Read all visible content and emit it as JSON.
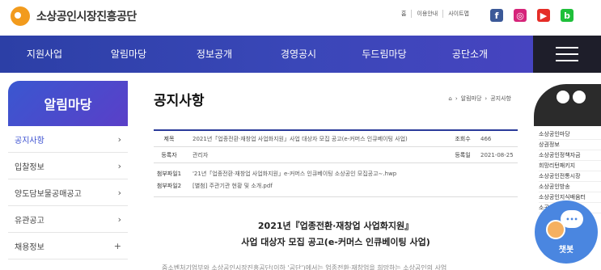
{
  "header": {
    "org_name": "소상공인시장진흥공단",
    "util_links": [
      "홈",
      "이용안내",
      "사이트맵"
    ],
    "sns": [
      {
        "name": "facebook-icon",
        "glyph": "f",
        "color": "#3b5998"
      },
      {
        "name": "instagram-icon",
        "glyph": "◎",
        "color": "#d6247a"
      },
      {
        "name": "youtube-icon",
        "glyph": "▶",
        "color": "#e52d27"
      },
      {
        "name": "blog-icon",
        "glyph": "b",
        "color": "#1fbf3a"
      }
    ]
  },
  "nav": {
    "items": [
      "지원사업",
      "알림마당",
      "정보공개",
      "경영공시",
      "두드림마당",
      "공단소개"
    ]
  },
  "sidebar": {
    "title": "알림마당",
    "items": [
      {
        "label": "공지사항",
        "arrow": "›"
      },
      {
        "label": "입찰정보",
        "arrow": "›"
      },
      {
        "label": "양도담보물공매공고",
        "arrow": "›"
      },
      {
        "label": "유관공고",
        "arrow": "›"
      },
      {
        "label": "채용정보",
        "arrow": "+"
      }
    ]
  },
  "main": {
    "title": "공지사항",
    "breadcrumb": [
      "알림마당",
      "공지사항"
    ],
    "info": {
      "subject_label": "제목",
      "subject": "2021년「업종전환·재창업 사업화지원」사업 대상자 모집 공고(e-커머스 인큐베이팅 사업)",
      "views_label": "조회수",
      "views": "466",
      "author_label": "등록자",
      "author": "관리자",
      "date_label": "등록일",
      "date": "2021-08-25",
      "files": [
        {
          "label": "첨부파일1",
          "name": "'21년「업종전환·재창업 사업화지원」e-커머스 인큐베이팅 소상공인 모집공고∼.hwp"
        },
        {
          "label": "첨부파일2",
          "name": "[별첨] 주관기관 현황 및 소개.pdf"
        }
      ]
    },
    "post_title_line1": "2021년『업종전환·재창업 사업화지원』",
    "post_title_line2": "사업 대상자 모집 공고(e-커머스 인큐베이팅 사업)",
    "body_fragment": "중소벤처기업부와 소상공인시장진흥공단(이하 '공단')에서는 업종전환·재창업을 희망하는 소상공인의 사업"
  },
  "quick_menu": {
    "items": [
      "소상공인마당",
      "상권정보",
      "소상공인정책자금",
      "희망리턴패키지",
      "소상공인전통시장",
      "소상공인방송",
      "소상공인지식배움터",
      "소공인종합지원"
    ]
  },
  "chatbot": {
    "label": "챗봇",
    "bubble": "•••"
  }
}
